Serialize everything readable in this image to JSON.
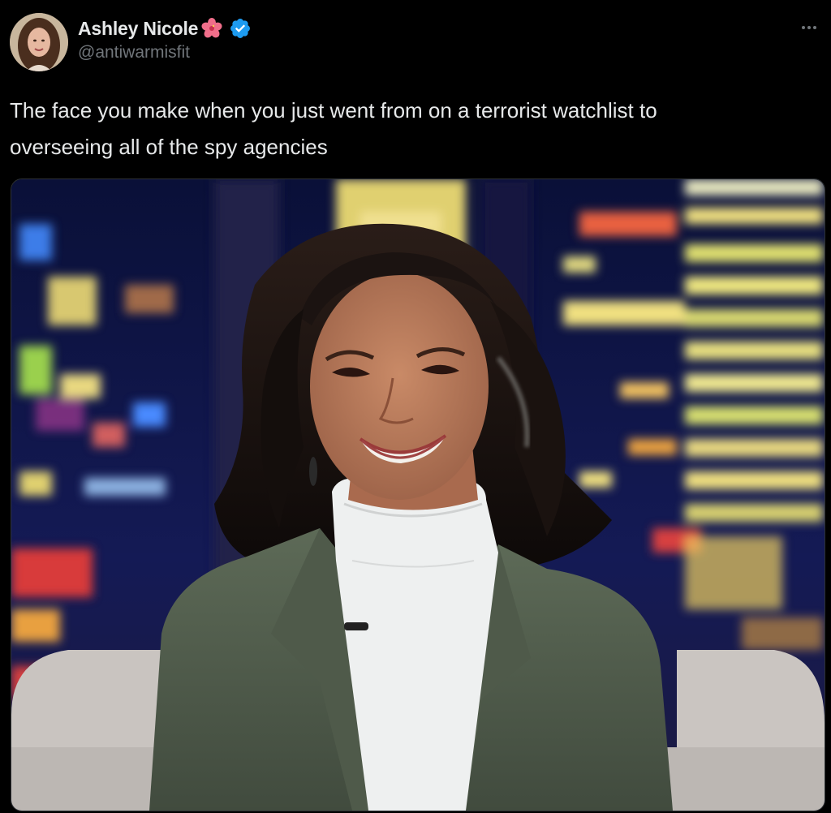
{
  "author": {
    "display_name": "Ashley Nicole",
    "handle": "@antiwarmisfit",
    "name_emoji": "hibiscus-flower-icon",
    "verified_badge": "verified-badge-icon",
    "verified_color": "#1d9bf0"
  },
  "menu": {
    "icon": "more-horizontal-icon"
  },
  "tweet": {
    "text": "The face you make when you just went from on a terrorist watchlist to\noverseeing all of the spy agencies"
  },
  "media": {
    "kind": "photo",
    "scene": "woman-in-green-blazer-and-white-turtleneck-smiling-on-tv-set-with-night-city-backdrop"
  },
  "colors": {
    "background": "#000000",
    "text_primary": "#e7e9ea",
    "text_secondary": "#71767b"
  }
}
